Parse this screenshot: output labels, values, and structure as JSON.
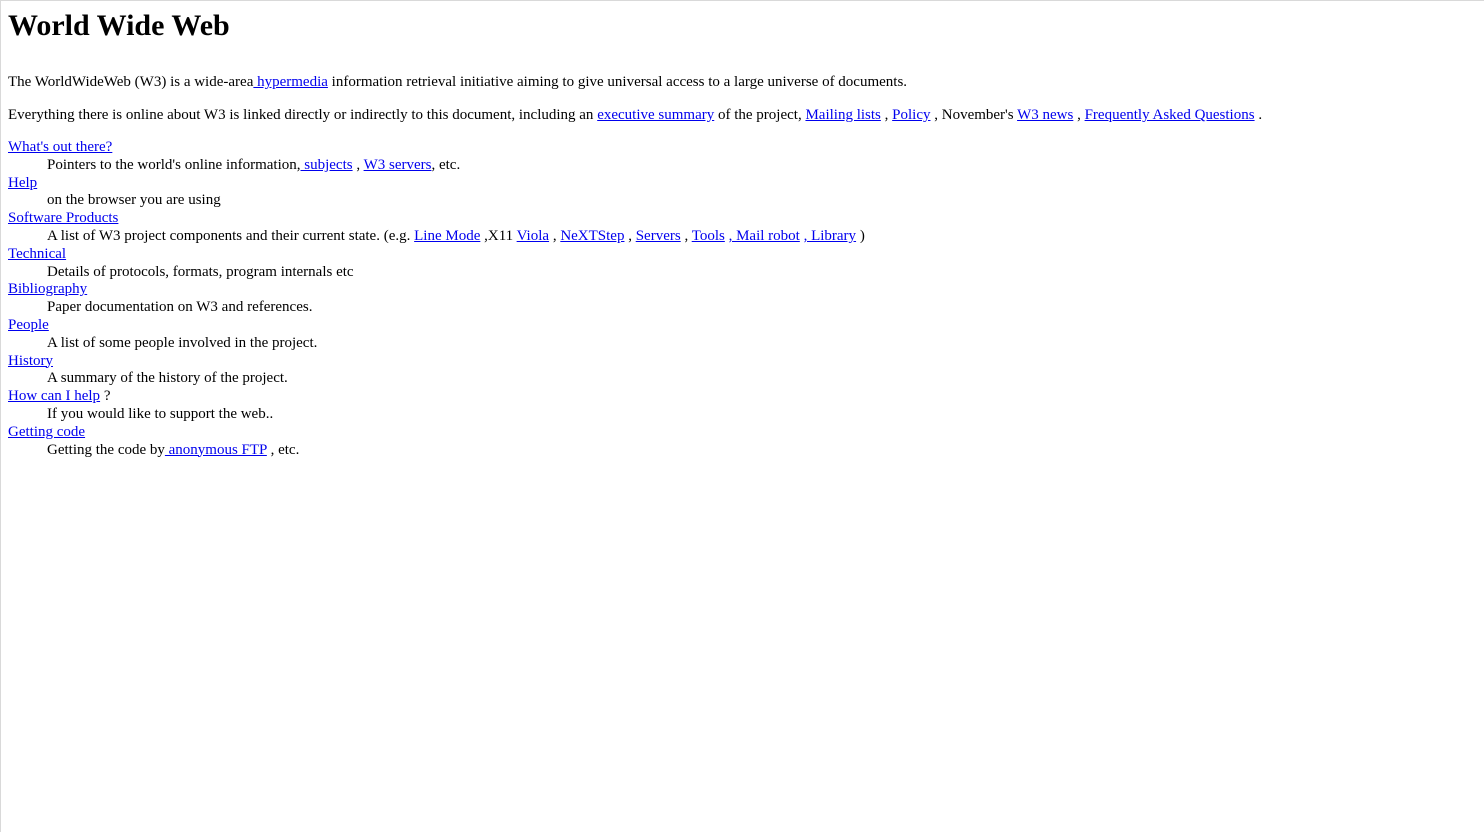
{
  "title": "World Wide Web",
  "intro1": {
    "before": "The WorldWideWeb (W3) is a wide-area",
    "link_hypermedia": " hypermedia",
    "after": " information retrieval initiative aiming to give universal access to a large universe of documents."
  },
  "intro2": {
    "before": "Everything there is online about W3 is linked directly or indirectly to this document, including an ",
    "link_executive_summary": "executive summary",
    "t1": " of the project, ",
    "link_mailing_lists": "Mailing lists",
    "t2": " , ",
    "link_policy": "Policy",
    "t3": " , November's ",
    "link_w3_news": "W3 news",
    "t4": " , ",
    "link_faq": "Frequently Asked Questions",
    "t5": " ."
  },
  "items": {
    "whats_out_there": {
      "term": "What's out there?",
      "desc_before": "Pointers to the world's online information,",
      "link_subjects": " subjects",
      "desc_mid": " , ",
      "link_w3_servers": "W3 servers",
      "desc_after": ", etc."
    },
    "help": {
      "term": "Help",
      "desc": "on the browser you are using"
    },
    "software_products": {
      "term": "Software Products",
      "desc_before": "A list of W3 project components and their current state. (e.g. ",
      "link_line_mode": "Line Mode",
      "s1": " ,X11 ",
      "link_viola": "Viola",
      "s2": " , ",
      "link_nextstep": "NeXTStep",
      "s3": " , ",
      "link_servers": "Servers",
      "s4": " , ",
      "link_tools": "Tools",
      "s5": " ",
      "link_mail_robot": ", Mail robot",
      "s6": " ",
      "link_library": ", Library",
      "desc_after": " )"
    },
    "technical": {
      "term": "Technical",
      "desc": "Details of protocols, formats, program internals etc"
    },
    "bibliography": {
      "term": "Bibliography",
      "desc": "Paper documentation on W3 and references."
    },
    "people": {
      "term": "People",
      "desc": "A list of some people involved in the project."
    },
    "history": {
      "term": "History",
      "desc": "A summary of the history of the project."
    },
    "how_can_i_help": {
      "term": "How can I help",
      "term_suffix": " ?",
      "desc": "If you would like to support the web.."
    },
    "getting_code": {
      "term": "Getting code",
      "desc_before": "Getting the code by",
      "link_anonymous_ftp": " anonymous FTP",
      "desc_after": " , etc."
    }
  },
  "colors": {
    "link": "#0000ee",
    "text": "#000000",
    "background": "#ffffff"
  }
}
